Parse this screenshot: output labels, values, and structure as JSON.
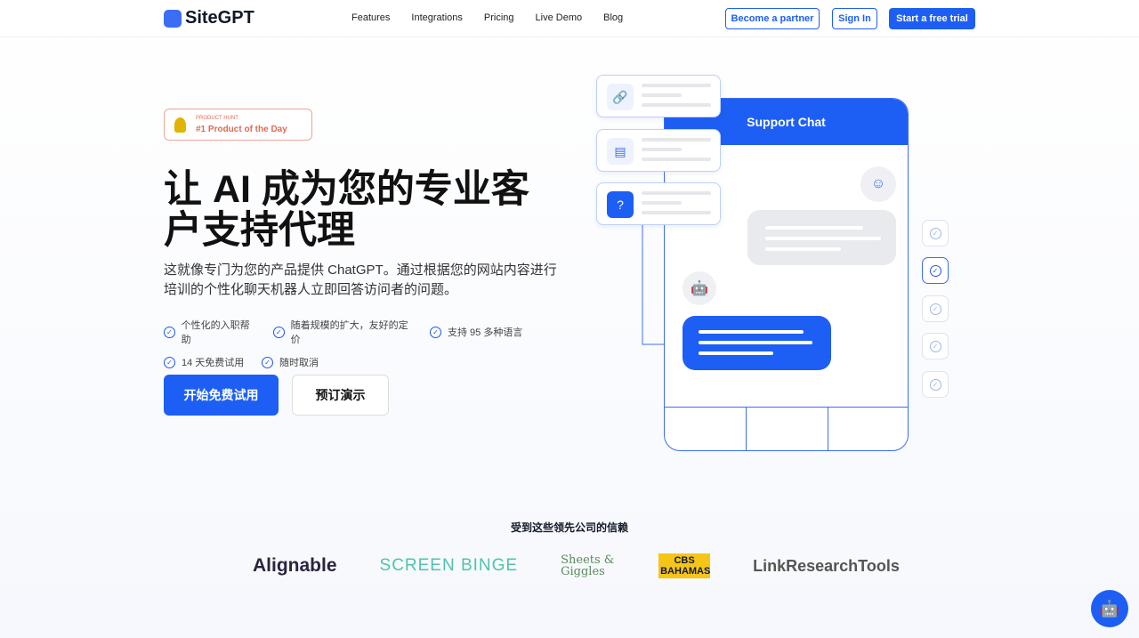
{
  "nav": {
    "brand": "SiteGPT",
    "links": [
      "Features",
      "Integrations",
      "Pricing",
      "Live Demo",
      "Blog"
    ],
    "partner": "Become a partner",
    "signin": "Sign In",
    "trial": "Start a free trial"
  },
  "badge": {
    "small": "PRODUCT HUNT",
    "main": "#1 Product of the Day"
  },
  "hero": {
    "title": "让 AI 成为您的专业客户支持代理",
    "subtitle": "这就像专门为您的产品提供 ChatGPT。通过根据您的网站内容进行培训的个性化聊天机器人立即回答访问者的问题。",
    "features": [
      "个性化的入职帮助",
      "随着规模的扩大，友好的定价",
      "支持 95 多种语言",
      "14 天免费试用",
      "随时取消"
    ],
    "cta_primary": "开始免费试用",
    "cta_secondary": "预订演示"
  },
  "chat": {
    "title": "Support Chat",
    "cards": [
      "link-icon",
      "document-icon",
      "help-icon"
    ]
  },
  "trust": {
    "title": "受到这些领先公司的信赖",
    "logos": [
      "Alignable",
      "SCREEN BINGE",
      "Sheets & Giggles",
      "CBS BAHAMAS",
      "LinkResearchTools"
    ]
  },
  "colors": {
    "accent": "#1d5ff5",
    "badge": "#e06a55"
  }
}
